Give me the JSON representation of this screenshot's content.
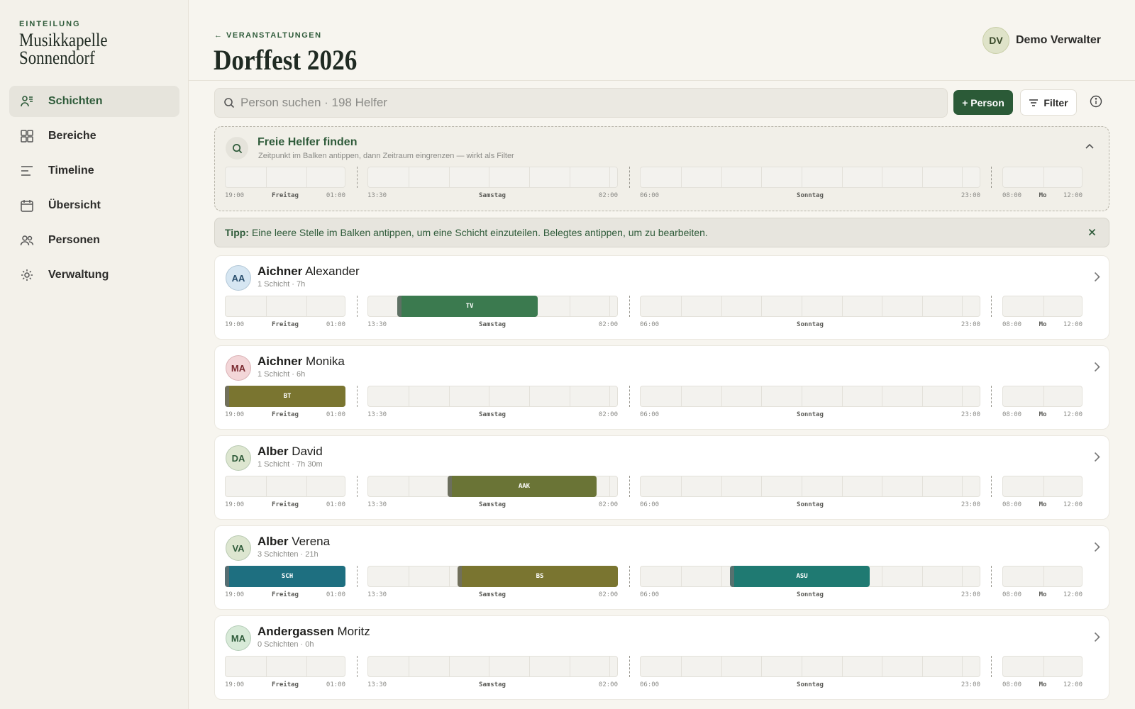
{
  "sidebar": {
    "kicker": "EINTEILUNG",
    "org_line1": "Musikkapelle",
    "org_line2": "Sonnendorf",
    "items": [
      {
        "label": "Schichten",
        "icon": "shifts-icon",
        "active": true
      },
      {
        "label": "Bereiche",
        "icon": "grid-icon",
        "active": false
      },
      {
        "label": "Timeline",
        "icon": "timeline-icon",
        "active": false
      },
      {
        "label": "Übersicht",
        "icon": "calendar-icon",
        "active": false
      },
      {
        "label": "Personen",
        "icon": "people-icon",
        "active": false
      },
      {
        "label": "Verwaltung",
        "icon": "settings-icon",
        "active": false
      }
    ]
  },
  "header": {
    "back_label": "← VERANSTALTUNGEN",
    "title": "Dorffest 2026",
    "user_initials": "DV",
    "user_name": "Demo Verwalter"
  },
  "toolbar": {
    "search_placeholder": "Person suchen · 198 Helfer",
    "add_label": "+ Person",
    "filter_label": "Filter"
  },
  "finder": {
    "title": "Freie Helfer finden",
    "subtitle": "Zeitpunkt im Balken antippen, dann Zeitraum eingrenzen — wirkt als Filter"
  },
  "tip": {
    "label": "Tipp:",
    "text": "Eine leere Stelle im Balken antippen, um eine Schicht einzuteilen. Belegtes antippen, um zu bearbeiten."
  },
  "timeline_labels": {
    "fri_start": "19:00",
    "fri_day": "Freitag",
    "fri_end": "01:00",
    "sat_start": "13:30",
    "sat_day": "Samstag",
    "sat_end": "02:00",
    "sun_start": "06:00",
    "sun_day": "Sonntag",
    "sun_end": "23:00",
    "mon_start": "08:00",
    "mon_day": "Mo",
    "mon_end": "12:00"
  },
  "colors": {
    "accent": "#2f5b3a",
    "tv": "#3b7a4f",
    "olive": "#7a7530",
    "olive_dark": "#6a7436",
    "teal": "#1e6f80",
    "teal_green": "#1f7a72"
  },
  "people": [
    {
      "initials": "AA",
      "last": "Aichner",
      "first": "Alexander",
      "meta": "1 Schicht · 7h",
      "avatar_bg": "#d6e6f2",
      "avatar_fg": "#2a4f6e",
      "shifts": [
        {
          "label": "TV",
          "day": "sat",
          "start": 0.12,
          "end": 0.68,
          "color": "#3b7a4f"
        }
      ]
    },
    {
      "initials": "MA",
      "last": "Aichner",
      "first": "Monika",
      "meta": "1 Schicht · 6h",
      "avatar_bg": "#f3d6d8",
      "avatar_fg": "#7a2a30",
      "shifts": [
        {
          "label": "BT",
          "day": "fri",
          "start": 0.0,
          "end": 1.0,
          "color": "#7a7530"
        }
      ]
    },
    {
      "initials": "DA",
      "last": "Alber",
      "first": "David",
      "meta": "1 Schicht · 7h 30m",
      "avatar_bg": "#dde6d0",
      "avatar_fg": "#2f5b3a",
      "shifts": [
        {
          "label": "AAK",
          "day": "sat",
          "start": 0.32,
          "end": 0.915,
          "color": "#6a7436"
        }
      ]
    },
    {
      "initials": "VA",
      "last": "Alber",
      "first": "Verena",
      "meta": "3 Schichten · 21h",
      "avatar_bg": "#dde6d0",
      "avatar_fg": "#2f5b3a",
      "shifts": [
        {
          "label": "SCH",
          "day": "fri",
          "start": 0.0,
          "end": 1.0,
          "color": "#1e6f80"
        },
        {
          "label": "BS",
          "day": "sat",
          "start": 0.36,
          "end": 1.0,
          "color": "#7a7530"
        },
        {
          "label": "ASU",
          "day": "sun",
          "start": 0.265,
          "end": 0.675,
          "color": "#1f7a72"
        }
      ]
    },
    {
      "initials": "MA",
      "last": "Andergassen",
      "first": "Moritz",
      "meta": "0 Schichten · 0h",
      "avatar_bg": "#d8ead8",
      "avatar_fg": "#2f5b3a",
      "shifts": []
    }
  ]
}
